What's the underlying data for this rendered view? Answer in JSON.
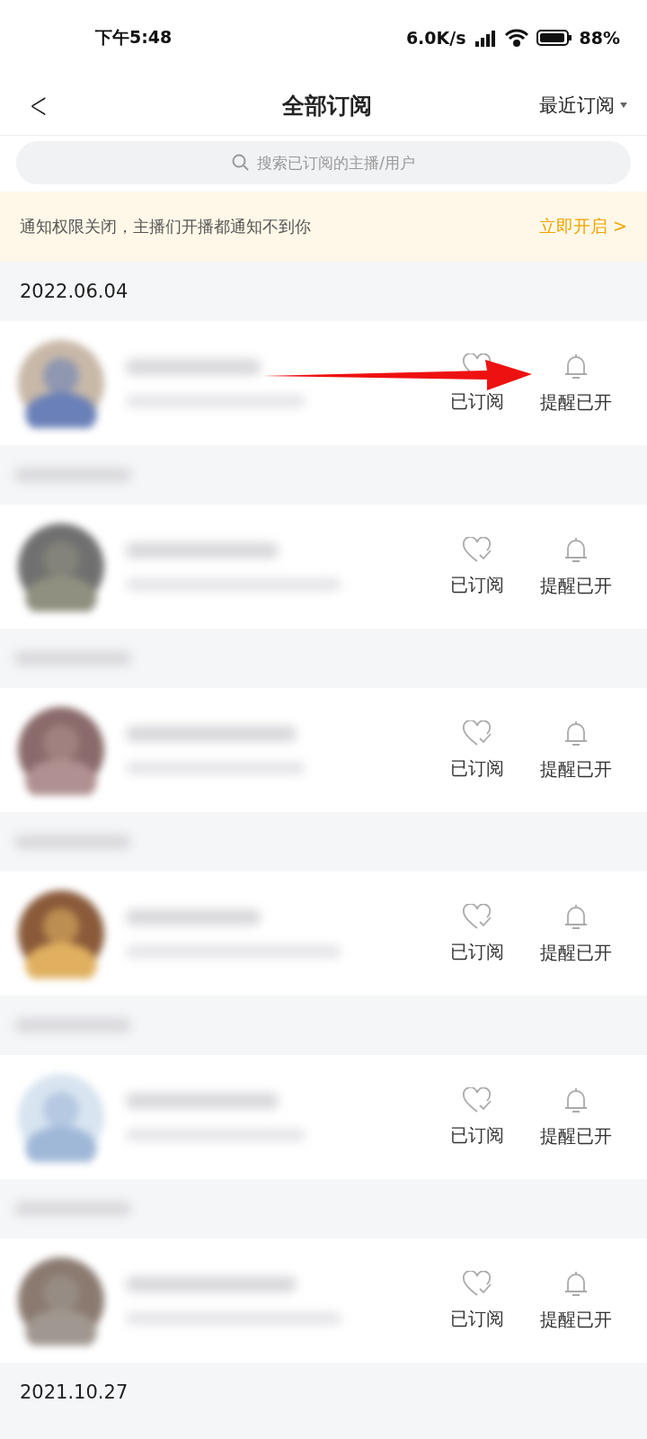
{
  "status_bar": {
    "time": "下午5:48",
    "speed": "6.0K/s",
    "battery": "88%"
  },
  "header": {
    "back": "<",
    "title": "全部订阅",
    "sort": "最近订阅"
  },
  "search": {
    "placeholder": "搜索已订阅的主播/用户"
  },
  "notice": {
    "text": "通知权限关闭，主播们开播都通知不到你",
    "action": "立即开启 >"
  },
  "groups": [
    {
      "date": "2022.06.04",
      "rows": [
        {
          "subscribed": "已订阅",
          "reminder": "提醒已开"
        }
      ]
    },
    {
      "rows": [
        {
          "subscribed": "已订阅",
          "reminder": "提醒已开"
        }
      ]
    },
    {
      "rows": [
        {
          "subscribed": "已订阅",
          "reminder": "提醒已开"
        }
      ]
    },
    {
      "rows": [
        {
          "subscribed": "已订阅",
          "reminder": "提醒已开"
        }
      ]
    },
    {
      "rows": [
        {
          "subscribed": "已订阅",
          "reminder": "提醒已开"
        }
      ]
    },
    {
      "rows": [
        {
          "subscribed": "已订阅",
          "reminder": "提醒已开"
        }
      ]
    },
    {
      "date": "2021.10.27"
    }
  ]
}
